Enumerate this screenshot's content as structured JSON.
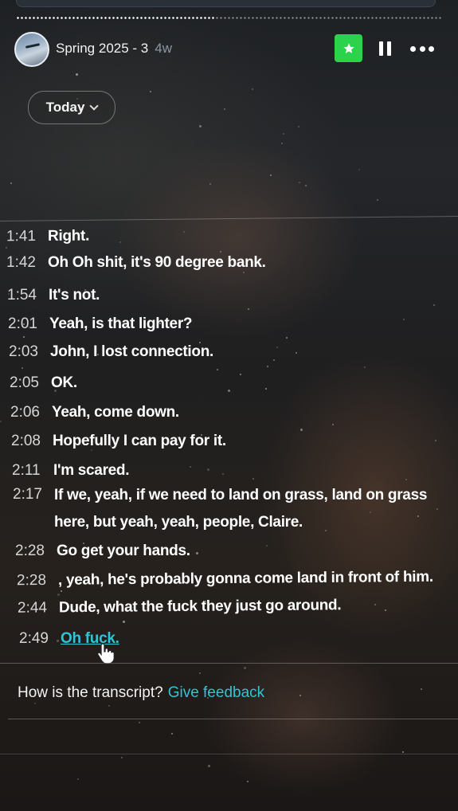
{
  "player": {
    "title": "Spring 2025 - 3",
    "age": "4w",
    "progress_fraction": 0.47
  },
  "date_filter": {
    "label": "Today"
  },
  "transcript": [
    {
      "time": "1:41",
      "text": "Right."
    },
    {
      "time": "1:42",
      "text": "Oh Oh shit, it's 90 degree bank."
    },
    {
      "time": "1:54",
      "text": "It's not."
    },
    {
      "time": "2:01",
      "text": "Yeah, is that lighter?"
    },
    {
      "time": "2:03",
      "text": "John, I lost connection."
    },
    {
      "time": "2:05",
      "text": "OK."
    },
    {
      "time": "2:06",
      "text": "Yeah, come down."
    },
    {
      "time": "2:08",
      "text": "Hopefully I can pay for it."
    },
    {
      "time": "2:11",
      "text": "I'm scared."
    },
    {
      "time": "2:17",
      "text": "If we, yeah, if we need to land on grass, land on grass",
      "text2": "here, but yeah, yeah, people, Claire."
    },
    {
      "time": "2:28",
      "text": "Go get your hands."
    },
    {
      "time": "2:28",
      "text": ", yeah, he's probably gonna come land in front of him."
    },
    {
      "time": "2:44",
      "text": "Dude, what the fuck they just go around."
    },
    {
      "time": "2:49",
      "text": "Oh fuck."
    }
  ],
  "feedback": {
    "question": "How is the transcript?",
    "link": "Give feedback"
  },
  "icons": {
    "star": "star-icon",
    "pause": "pause-icon",
    "more": "more-icon",
    "chevron": "chevron-down-icon",
    "cursor": "hand-cursor-icon"
  },
  "colors": {
    "accent_green": "#2bd24b",
    "link_cyan": "#2fc4d6"
  }
}
